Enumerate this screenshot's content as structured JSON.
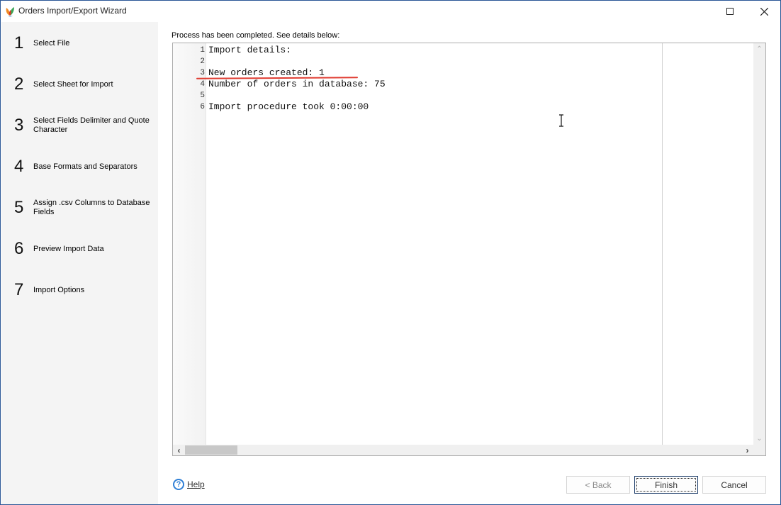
{
  "window": {
    "title": "Orders Import/Export Wizard",
    "maximize_icon": "maximize-icon",
    "close_icon": "close-icon"
  },
  "sidebar": {
    "steps": [
      {
        "number": "1",
        "label": "Select File"
      },
      {
        "number": "2",
        "label": "Select Sheet for Import"
      },
      {
        "number": "3",
        "label": "Select Fields Delimiter and Quote Character"
      },
      {
        "number": "4",
        "label": "Base Formats and Separators"
      },
      {
        "number": "5",
        "label": "Assign .csv Columns to Database Fields"
      },
      {
        "number": "6",
        "label": "Preview Import Data"
      },
      {
        "number": "7",
        "label": "Import Options"
      }
    ]
  },
  "main": {
    "status_text": "Process has been completed. See details below:",
    "log_lines": [
      {
        "no": "1",
        "text": "Import details:"
      },
      {
        "no": "2",
        "text": ""
      },
      {
        "no": "3",
        "text": "New orders created: 1"
      },
      {
        "no": "4",
        "text": "Number of orders in database: 75"
      },
      {
        "no": "5",
        "text": ""
      },
      {
        "no": "6",
        "text": "Import procedure took 0:00:00"
      }
    ],
    "highlight_color": "#e03c31"
  },
  "footer": {
    "help_label": "Help",
    "back_label": "< Back",
    "finish_label": "Finish",
    "cancel_label": "Cancel"
  }
}
